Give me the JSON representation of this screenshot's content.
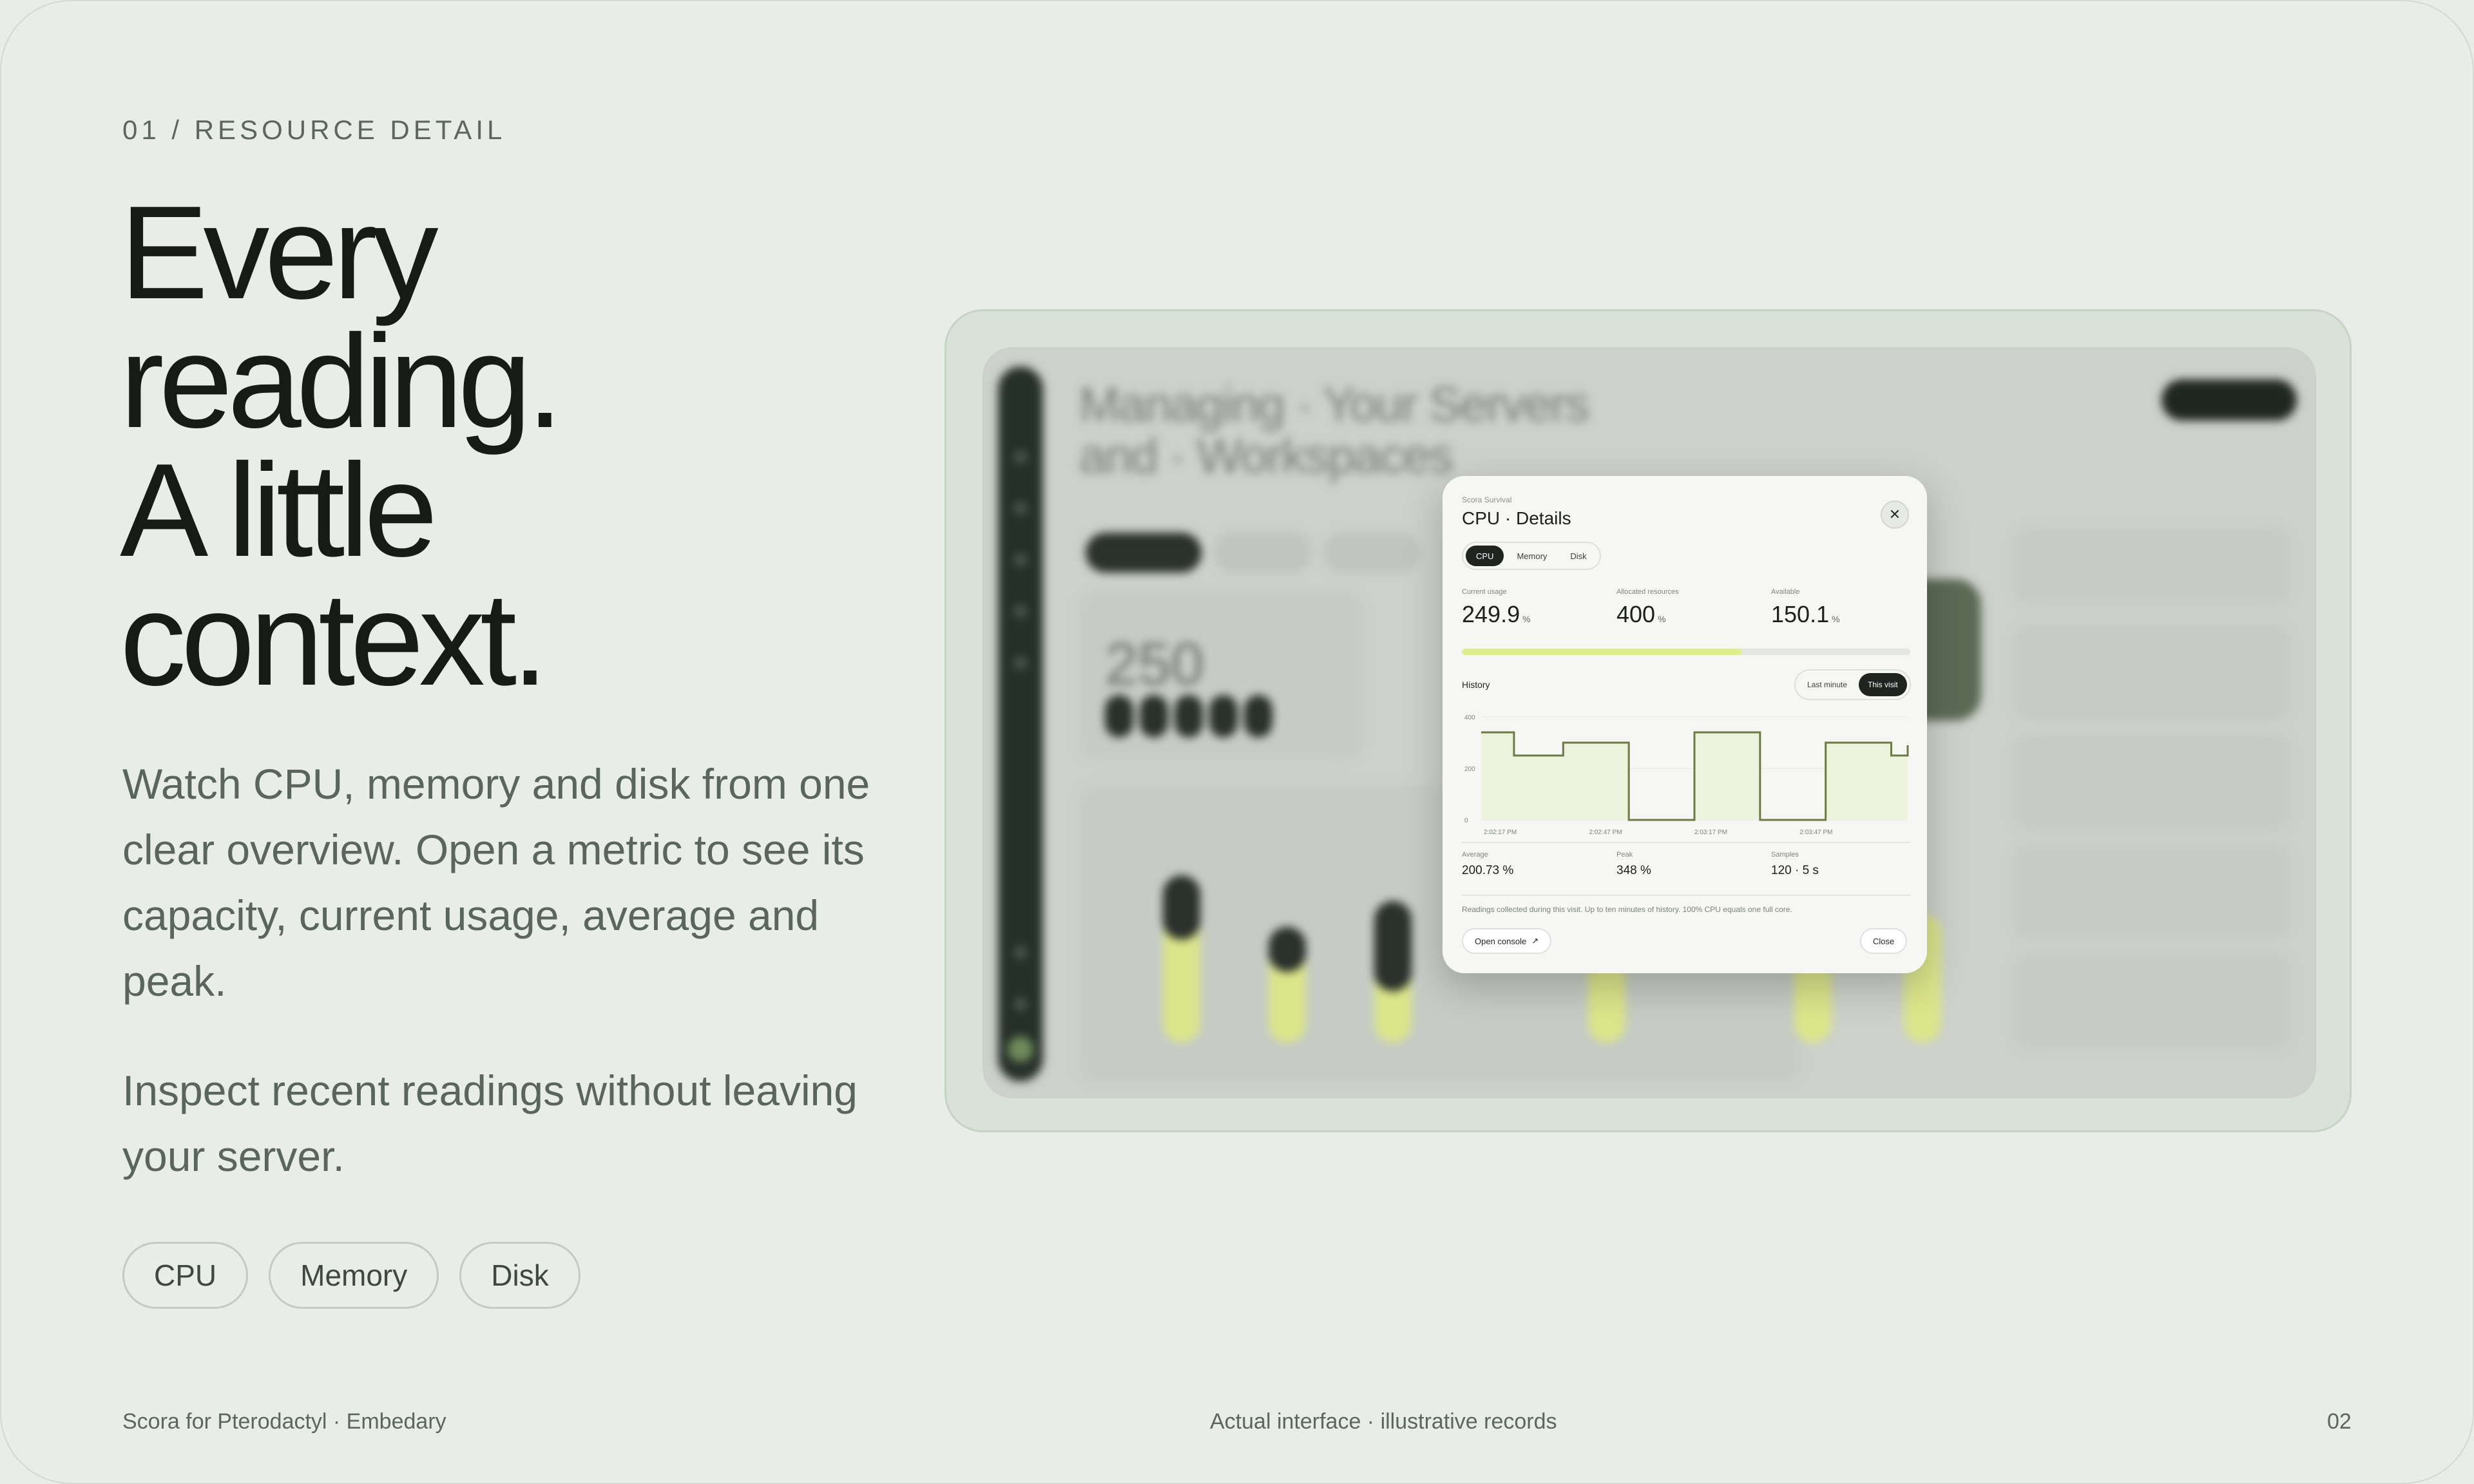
{
  "slide": {
    "eyebrow": "01 / RESOURCE DETAIL",
    "headline": [
      "Every",
      "reading.",
      "A little",
      "context."
    ],
    "paragraph_1": "Watch CPU, memory and disk from one clear overview. Open a metric to see its capacity, current usage, average and peak.",
    "paragraph_2": "Inspect recent readings without leaving your server.",
    "chips": [
      "CPU",
      "Memory",
      "Disk"
    ],
    "footer": {
      "left": "Scora for Pterodactyl · Embedary",
      "center": "Actual interface · illustrative records",
      "right": "02"
    }
  },
  "app_background": {
    "title_line_1": "Managing · Your Servers",
    "title_line_2": "and · Workspaces",
    "big_number": "250"
  },
  "modal": {
    "subtitle": "Scora Survival",
    "title": "CPU · Details",
    "close_icon": "close-icon",
    "tabs": [
      {
        "label": "CPU",
        "active": true
      },
      {
        "label": "Memory",
        "active": false
      },
      {
        "label": "Disk",
        "active": false
      }
    ],
    "stats": [
      {
        "label": "Current usage",
        "value": "249.9",
        "unit": "%"
      },
      {
        "label": "Allocated resources",
        "value": "400",
        "unit": "%"
      },
      {
        "label": "Available",
        "value": "150.1",
        "unit": "%"
      }
    ],
    "usage_fraction": 0.625,
    "history_label": "History",
    "range_options": [
      {
        "label": "Last minute",
        "active": false
      },
      {
        "label": "This visit",
        "active": true
      }
    ],
    "summary": [
      {
        "label": "Average",
        "value": "200.73 %"
      },
      {
        "label": "Peak",
        "value": "348 %"
      },
      {
        "label": "Samples",
        "value": "120 · 5 s"
      }
    ],
    "note": "Readings collected during this visit. Up to ten minutes of history. 100% CPU equals one full core.",
    "open_console": "Open console",
    "close_button": "Close",
    "colors": {
      "accent": "#dff08a",
      "line": "#6e7a43",
      "fill": "#edf2dd",
      "dark": "#1f2420"
    }
  },
  "chart_data": {
    "type": "line",
    "title": "History",
    "ylim": [
      0,
      400
    ],
    "y_ticks": [
      "400",
      "200",
      "0"
    ],
    "x_ticks": [
      "2:02:17 PM",
      "2:02:47 PM",
      "2:03:17 PM",
      "2:03:47 PM"
    ],
    "series": [
      {
        "values": [
          340,
          340,
          340,
          340,
          250,
          250,
          250,
          250,
          250,
          250,
          300,
          300,
          300,
          300,
          300,
          300,
          300,
          300,
          0,
          0,
          0,
          0,
          0,
          0,
          0,
          0,
          340,
          340,
          340,
          340,
          340,
          340,
          340,
          340,
          0,
          0,
          0,
          0,
          0,
          0,
          0,
          0,
          300,
          300,
          300,
          300,
          300,
          300,
          300,
          300,
          250,
          250,
          290
        ]
      }
    ]
  }
}
